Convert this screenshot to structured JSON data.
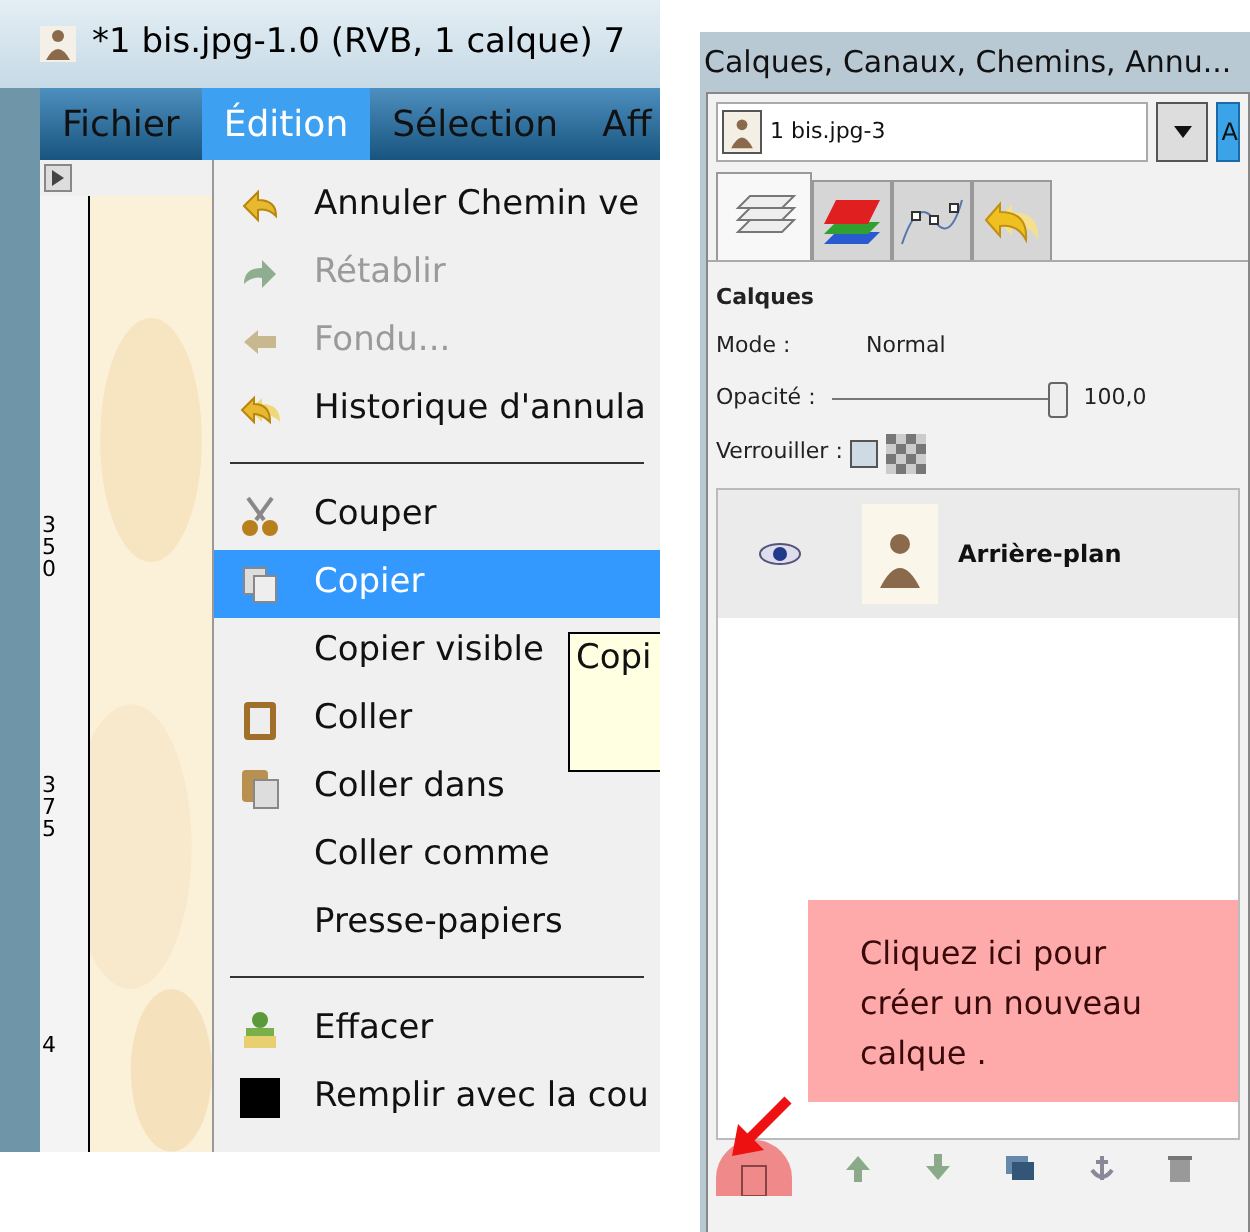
{
  "image_window": {
    "title": "*1 bis.jpg-1.0 (RVB, 1 calque) 7",
    "menubar": [
      {
        "label": "Fichier",
        "selected": false
      },
      {
        "label": "Édition",
        "selected": true
      },
      {
        "label": "Sélection",
        "selected": false
      },
      {
        "label": "Aff",
        "selected": false
      }
    ],
    "ruler_labels": [
      "350",
      "375",
      "4"
    ],
    "edit_menu": [
      {
        "kind": "item",
        "label": "Annuler Chemin ve",
        "disabled": false,
        "selected": false
      },
      {
        "kind": "item",
        "label": "Rétablir",
        "disabled": true,
        "selected": false
      },
      {
        "kind": "item",
        "label": "Fondu...",
        "disabled": true,
        "selected": false
      },
      {
        "kind": "item",
        "label": "Historique d'annula",
        "disabled": false,
        "selected": false
      },
      {
        "kind": "separator"
      },
      {
        "kind": "item",
        "label": "Couper",
        "disabled": false,
        "selected": false
      },
      {
        "kind": "item",
        "label": "Copier",
        "disabled": false,
        "selected": true
      },
      {
        "kind": "item",
        "label": "Copier visible",
        "disabled": false,
        "selected": false
      },
      {
        "kind": "item",
        "label": "Coller",
        "disabled": false,
        "selected": false
      },
      {
        "kind": "item",
        "label": "Coller dans",
        "disabled": false,
        "selected": false
      },
      {
        "kind": "item",
        "label": "Coller comme",
        "disabled": false,
        "selected": false
      },
      {
        "kind": "item",
        "label": "Presse-papiers",
        "disabled": false,
        "selected": false
      },
      {
        "kind": "separator"
      },
      {
        "kind": "item",
        "label": "Effacer",
        "disabled": false,
        "selected": false
      },
      {
        "kind": "item",
        "label": "Remplir avec la cou",
        "disabled": false,
        "selected": false
      }
    ],
    "tooltip": "Copi"
  },
  "layers_dock": {
    "title": "Calques, Canaux, Chemins, Annu...",
    "image_selector": "1 bis.jpg-3",
    "side_button": "A",
    "tabs": [
      {
        "selected": true
      },
      {
        "selected": false
      },
      {
        "selected": false
      },
      {
        "selected": false
      }
    ],
    "heading": "Calques",
    "mode_label": "Mode :",
    "mode_value": "Normal",
    "opacity_label": "Opacité :",
    "opacity": {
      "level": 1
    },
    "opacity_value": "100,0",
    "lock_label": "Verrouiller :",
    "lock_pixels": false,
    "layers": [
      {
        "name": "Arrière-plan",
        "visible": true
      }
    ],
    "annotation": "Cliquez ici pour créer un nouveau calque ."
  }
}
